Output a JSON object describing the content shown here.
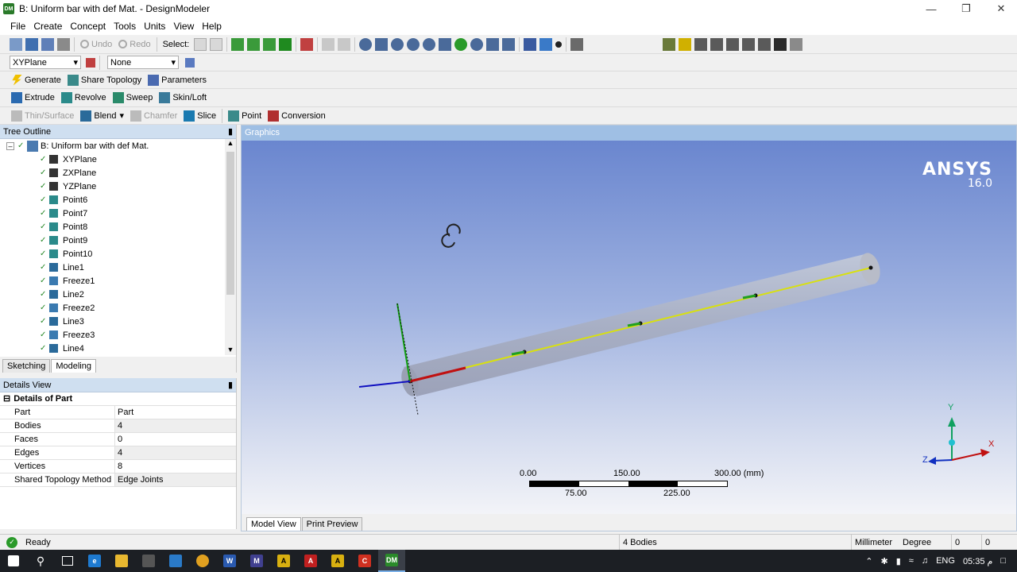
{
  "window": {
    "title": "B: Uniform bar with def Mat. - DesignModeler",
    "app_icon": "DM"
  },
  "menu": [
    "File",
    "Create",
    "Concept",
    "Tools",
    "Units",
    "View",
    "Help"
  ],
  "toolbar1": {
    "undo": "Undo",
    "redo": "Redo",
    "select": "Select:"
  },
  "plane_toolbar": {
    "plane": "XYPlane",
    "sketch": "None"
  },
  "toolbar3": {
    "generate": "Generate",
    "share_topology": "Share Topology",
    "parameters": "Parameters"
  },
  "toolbar4": {
    "extrude": "Extrude",
    "revolve": "Revolve",
    "sweep": "Sweep",
    "skin_loft": "Skin/Loft"
  },
  "toolbar5": {
    "thin_surface": "Thin/Surface",
    "blend": "Blend",
    "chamfer": "Chamfer",
    "slice": "Slice",
    "point": "Point",
    "conversion": "Conversion"
  },
  "tree": {
    "header": "Tree Outline",
    "root": "B: Uniform bar with def Mat.",
    "items": [
      {
        "label": "XYPlane",
        "icon": "plane-icon"
      },
      {
        "label": "ZXPlane",
        "icon": "plane-icon"
      },
      {
        "label": "YZPlane",
        "icon": "plane-icon"
      },
      {
        "label": "Point6",
        "icon": "point-feature-icon"
      },
      {
        "label": "Point7",
        "icon": "point-feature-icon"
      },
      {
        "label": "Point8",
        "icon": "point-feature-icon"
      },
      {
        "label": "Point9",
        "icon": "point-feature-icon"
      },
      {
        "label": "Point10",
        "icon": "point-feature-icon"
      },
      {
        "label": "Line1",
        "icon": "line-icon"
      },
      {
        "label": "Freeze1",
        "icon": "freeze-icon"
      },
      {
        "label": "Line2",
        "icon": "line-icon"
      },
      {
        "label": "Freeze2",
        "icon": "freeze-icon"
      },
      {
        "label": "Line3",
        "icon": "line-icon"
      },
      {
        "label": "Freeze3",
        "icon": "freeze-icon"
      },
      {
        "label": "Line4",
        "icon": "line-icon"
      }
    ],
    "tabs": [
      "Sketching",
      "Modeling"
    ]
  },
  "details": {
    "header": "Details View",
    "section": "Details of Part",
    "rows": [
      {
        "label": "Part",
        "value": "Part"
      },
      {
        "label": "Bodies",
        "value": "4"
      },
      {
        "label": "Faces",
        "value": "0"
      },
      {
        "label": "Edges",
        "value": "4"
      },
      {
        "label": "Vertices",
        "value": "8"
      },
      {
        "label": "Shared Topology Method",
        "value": "Edge Joints"
      }
    ]
  },
  "graphics": {
    "header": "Graphics",
    "brand": "ANSYS",
    "version": "16.0",
    "scale_top": [
      "0.00",
      "150.00",
      "300.00 (mm)"
    ],
    "scale_bottom": [
      "75.00",
      "225.00"
    ],
    "triad": {
      "x": "X",
      "y": "Y",
      "z": "Z"
    },
    "tabs": [
      "Model View",
      "Print Preview"
    ]
  },
  "status": {
    "state": "Ready",
    "selection": "4 Bodies",
    "units": "Millimeter",
    "angle": "Degree",
    "v1": "0",
    "v2": "0"
  },
  "taskbar": {
    "lang": "ENG",
    "time": "05:35 م"
  }
}
